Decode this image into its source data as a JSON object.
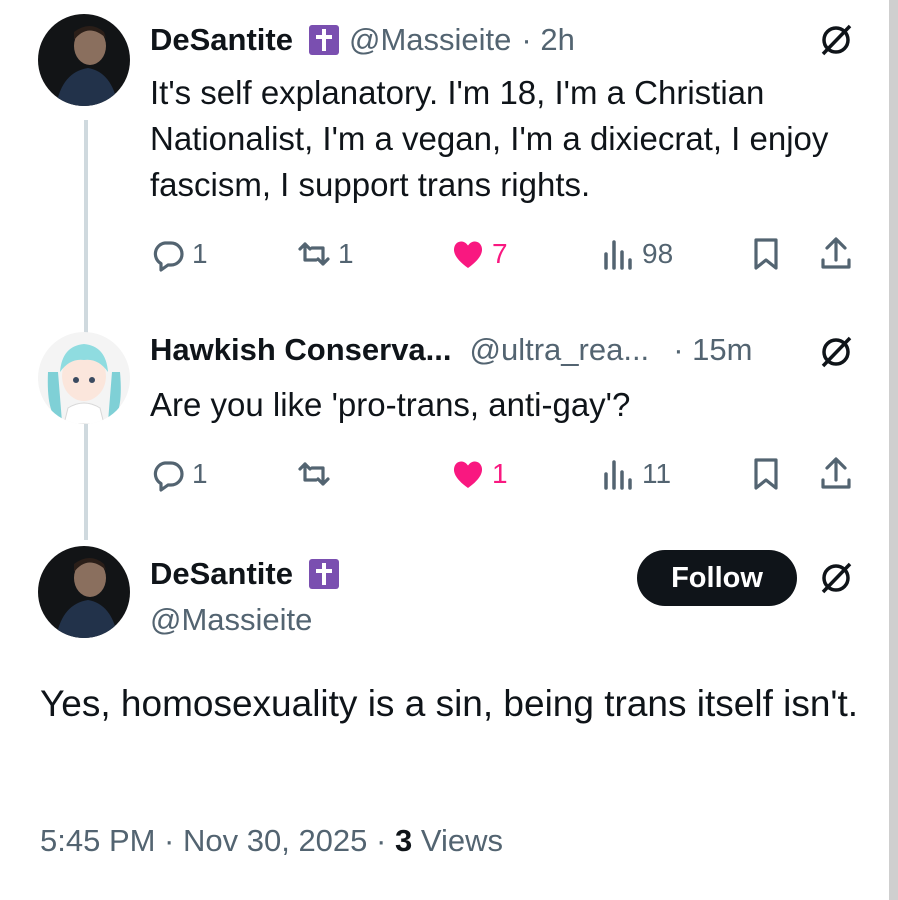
{
  "tweet1": {
    "name": "DeSantite",
    "handle": "@Massieite",
    "time": "· 2h",
    "text": "It's self explanatory. I'm 18, I'm a Christian Nationalist, I'm a vegan, I'm a dixiecrat, I enjoy fascism, I support trans rights.",
    "replies": "1",
    "reposts": "1",
    "likes": "7",
    "views": "98"
  },
  "tweet2": {
    "name": "Hawkish Conserva...",
    "handle": "@ultra_rea...",
    "time": "· 15m",
    "text": "Are you like 'pro-trans, anti-gay'?",
    "replies": "1",
    "reposts": "",
    "likes": "1",
    "views": "11"
  },
  "main_tweet": {
    "name": "DeSantite",
    "handle": "@Massieite",
    "follow_label": "Follow",
    "text": "Yes, homosexuality is a sin, being trans itself isn't.",
    "timestamp": "5:45 PM · Nov 30, 2025 ·",
    "views_count": "3",
    "views_label": "Views"
  },
  "colors": {
    "like": "#f91880",
    "muted": "#536471",
    "badge": "#7a4fb0"
  },
  "icons": [
    "reply-icon",
    "repost-icon",
    "like-icon",
    "views-icon",
    "bookmark-icon",
    "share-icon",
    "grok-icon",
    "cross-badge-icon"
  ]
}
